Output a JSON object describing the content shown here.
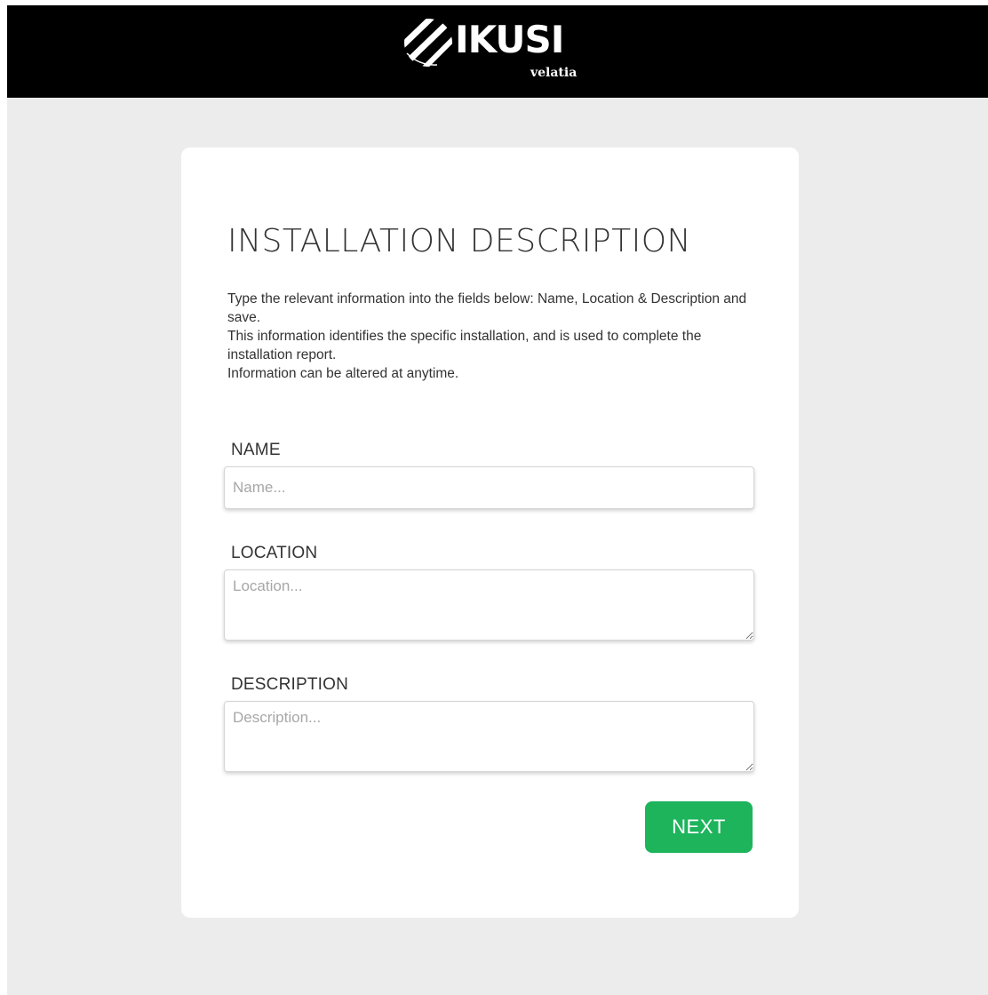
{
  "header": {
    "brand": "IKUSI",
    "brand_sub": "velatia"
  },
  "form": {
    "title": "INSTALLATION DESCRIPTION",
    "intro": [
      "Type the relevant information into the fields below: Name, Location & Description and save.",
      "This information identifies the specific installation, and is used to complete the installation report.",
      "Information can be altered at anytime."
    ],
    "fields": {
      "name": {
        "label": "NAME",
        "value": "",
        "placeholder": "Name..."
      },
      "location": {
        "label": "LOCATION",
        "value": "",
        "placeholder": "Location..."
      },
      "description": {
        "label": "DESCRIPTION",
        "value": "",
        "placeholder": "Description..."
      }
    },
    "next_label": "NEXT"
  },
  "colors": {
    "header_bg": "#000000",
    "page_bg": "#ececec",
    "card_bg": "#ffffff",
    "accent_button": "#1db45c"
  },
  "icons": {
    "logo": "ikusi-striped-globe-logo"
  }
}
